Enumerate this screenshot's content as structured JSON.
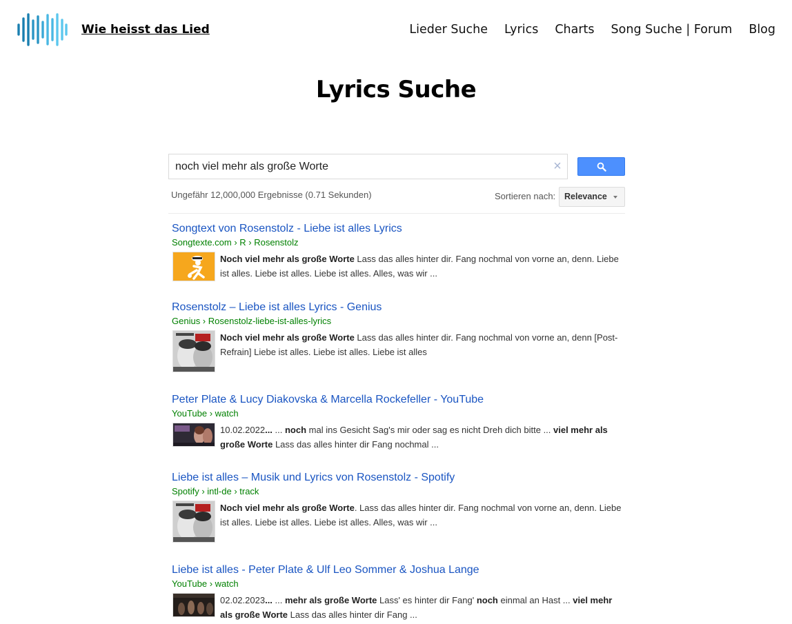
{
  "header": {
    "site_title": "Wie heisst das Lied",
    "nav": [
      "Lieder Suche",
      "Lyrics",
      "Charts",
      "Song Suche | Forum",
      "Blog"
    ]
  },
  "page_title": "Lyrics Suche",
  "search": {
    "query": "noch viel mehr als große Worte",
    "clear_symbol": "×",
    "button_icon": "magnifier-icon",
    "result_info": "Ungefähr 12,000,000 Ergebnisse (0.71 Sekunden)",
    "sort_label": "Sortieren nach:",
    "sort_value": "Relevance"
  },
  "colors": {
    "link": "#1a55c2",
    "url": "#008000",
    "button": "#4d90fe",
    "logo_dark": "#1a7fb0",
    "logo_light": "#5cc7ee"
  },
  "results": [
    {
      "title": "Songtext von Rosenstolz - Liebe ist alles Lyrics",
      "url": "Songtexte.com › R › Rosenstolz",
      "thumb": "songtexte-logo",
      "s1b": "Noch viel mehr als große Worte",
      "s1": " Lass das alles hinter dir. Fang nochmal von vorne an, denn. Liebe ist alles. Liebe ist alles. Liebe ist alles. Alles, was wir ..."
    },
    {
      "title": "Rosenstolz – Liebe ist alles Lyrics - Genius",
      "url": "Genius › Rosenstolz-liebe-ist-alles-lyrics",
      "thumb": "album-cover",
      "s1b": "Noch viel mehr als große Worte",
      "s1": " Lass das alles hinter dir. Fang nochmal von vorne an, denn [Post-Refrain] Liebe ist alles. Liebe ist alles. Liebe ist alles"
    },
    {
      "title": "Peter Plate & Lucy Diakovska & Marcella Rockefeller - YouTube",
      "url": "YouTube › watch",
      "thumb": "video-thumbnail",
      "date": "10.02.2022",
      "p1": " ... ",
      "p2": "noch",
      "p3": " mal ins Gesicht Sag's mir oder sag es nicht Dreh dich bitte ... ",
      "p4": "viel mehr als große Worte",
      "p5": " Lass das alles hinter dir Fang nochmal ..."
    },
    {
      "title": "Liebe ist alles – Musik und Lyrics von Rosenstolz - Spotify",
      "url": "Spotify › intl-de › track",
      "thumb": "album-cover",
      "s1b": "Noch viel mehr als große Worte",
      "s1": ". Lass das alles hinter dir. Fang nochmal von vorne an, denn. Liebe ist alles. Liebe ist alles. Liebe ist alles. Alles, was wir ..."
    },
    {
      "title": "Liebe ist alles - Peter Plate & Ulf Leo Sommer & Joshua Lange",
      "url": "YouTube › watch",
      "thumb": "video-thumbnail",
      "date": "02.02.2023",
      "p1": " ... ",
      "p2": "mehr als große Worte",
      "p3": " Lass' es hinter dir Fang' ",
      "p4": "noch",
      "p5": " einmal an Hast ... ",
      "p6": "viel mehr als große Worte",
      "p7": " Lass das alles hinter dir Fang ..."
    }
  ]
}
